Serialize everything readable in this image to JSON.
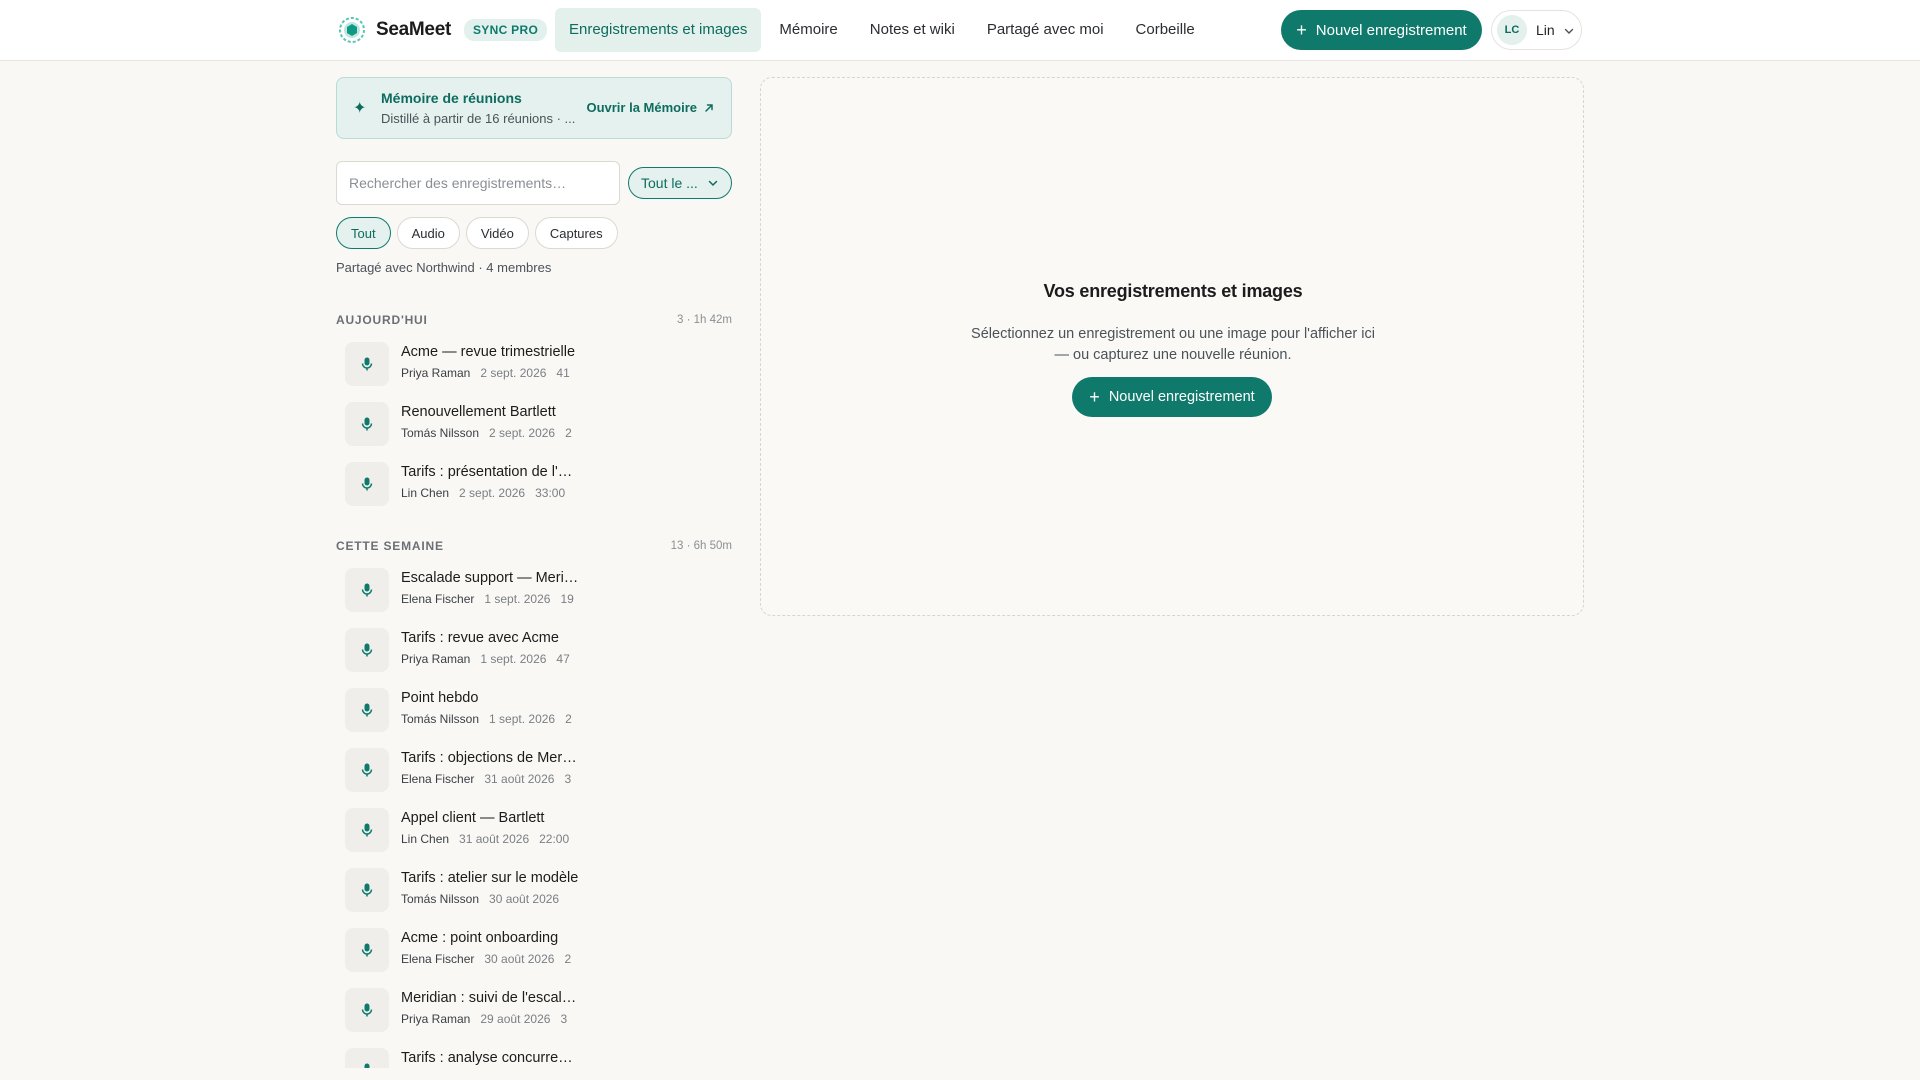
{
  "header": {
    "brand": "SeaMeet",
    "badge": "SYNC PRO",
    "nav": [
      {
        "label": "Enregistrements et images",
        "active": true
      },
      {
        "label": "Mémoire",
        "active": false
      },
      {
        "label": "Notes et wiki",
        "active": false
      },
      {
        "label": "Partagé avec moi",
        "active": false
      },
      {
        "label": "Corbeille",
        "active": false
      }
    ],
    "new_recording": "Nouvel enregistrement",
    "user": {
      "initials": "LC",
      "name": "Lin"
    }
  },
  "memory_card": {
    "title": "Mémoire de réunions",
    "subtitle": "Distillé à partir de 16 réunions · ...",
    "open_label": "Ouvrir la Mémoire"
  },
  "search": {
    "placeholder": "Rechercher des enregistrements…",
    "filter_value": "Tout le ..."
  },
  "type_filters": [
    {
      "label": "Tout",
      "active": true
    },
    {
      "label": "Audio",
      "active": false
    },
    {
      "label": "Vidéo",
      "active": false
    },
    {
      "label": "Captures",
      "active": false
    }
  ],
  "shared_note": "Partagé avec Northwind · 4 membres",
  "sections": [
    {
      "title": "AUJOURD'HUI",
      "meta": "3 · 1h 42m",
      "items": [
        {
          "title": "Acme — revue trimestrielle",
          "author": "Priya Raman",
          "date": "2 sept. 2026",
          "duration": "41"
        },
        {
          "title": "Renouvellement Bartlett",
          "author": "Tomás Nilsson",
          "date": "2 sept. 2026",
          "duration": "2"
        },
        {
          "title": "Tarifs : présentation de l'offre",
          "author": "Lin Chen",
          "date": "2 sept. 2026",
          "duration": "33:00"
        }
      ]
    },
    {
      "title": "CETTE SEMAINE",
      "meta": "13 · 6h 50m",
      "items": [
        {
          "title": "Escalade support — Meridian",
          "author": "Elena Fischer",
          "date": "1 sept. 2026",
          "duration": "19"
        },
        {
          "title": "Tarifs : revue avec Acme",
          "author": "Priya Raman",
          "date": "1 sept. 2026",
          "duration": "47"
        },
        {
          "title": "Point hebdo",
          "author": "Tomás Nilsson",
          "date": "1 sept. 2026",
          "duration": "2"
        },
        {
          "title": "Tarifs : objections de Meridian",
          "author": "Elena Fischer",
          "date": "31 août 2026",
          "duration": "3"
        },
        {
          "title": "Appel client — Bartlett",
          "author": "Lin Chen",
          "date": "31 août 2026",
          "duration": "22:00"
        },
        {
          "title": "Tarifs : atelier sur le modèle",
          "author": "Tomás Nilsson",
          "date": "30 août 2026",
          "duration": ""
        },
        {
          "title": "Acme : point onboarding",
          "author": "Elena Fischer",
          "date": "30 août 2026",
          "duration": "2"
        },
        {
          "title": "Meridian : suivi de l'escalade",
          "author": "Priya Raman",
          "date": "29 août 2026",
          "duration": "3"
        },
        {
          "title": "Tarifs : analyse concurrentielle",
          "author": "",
          "date": "",
          "duration": ""
        }
      ]
    }
  ],
  "detail": {
    "title": "Vos enregistrements et images",
    "description": "Sélectionnez un enregistrement ou une image pour l'afficher ici — ou capturez une nouvelle réunion.",
    "button": "Nouvel enregistrement"
  },
  "colors": {
    "accent": "#0f7a6c",
    "accent_soft": "#e4f1ee",
    "background": "#f9f8f5"
  },
  "icons": {
    "logo": "seameet-logo-icon",
    "plus": "plus-icon",
    "mic": "microphone-icon",
    "chevron": "chevron-down-icon",
    "open": "arrow-up-right-icon",
    "spark": "sparkle-icon"
  }
}
